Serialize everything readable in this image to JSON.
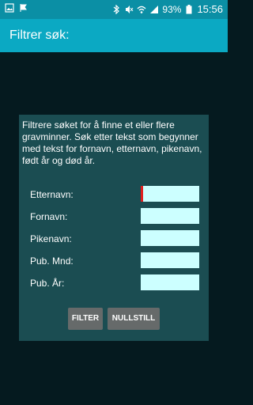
{
  "status_bar": {
    "left_icons": [
      "image-icon",
      "flag-icon"
    ],
    "battery": "93%",
    "time": "15:56"
  },
  "app_bar": {
    "title": "Filtrer søk:"
  },
  "panel": {
    "description": "Filtrere søket for å finne et eller flere gravminner. Søk etter tekst som begynner med tekst for fornavn, etternavn, pikenavn, født år og død år.",
    "fields": [
      {
        "label": "Etternavn:",
        "value": ""
      },
      {
        "label": "Fornavn:",
        "value": ""
      },
      {
        "label": "Pikenavn:",
        "value": ""
      },
      {
        "label": "Pub. Mnd:",
        "value": ""
      },
      {
        "label": "Pub. År:",
        "value": ""
      }
    ],
    "filter_label": "FILTER",
    "reset_label": "NULLSTILL"
  }
}
